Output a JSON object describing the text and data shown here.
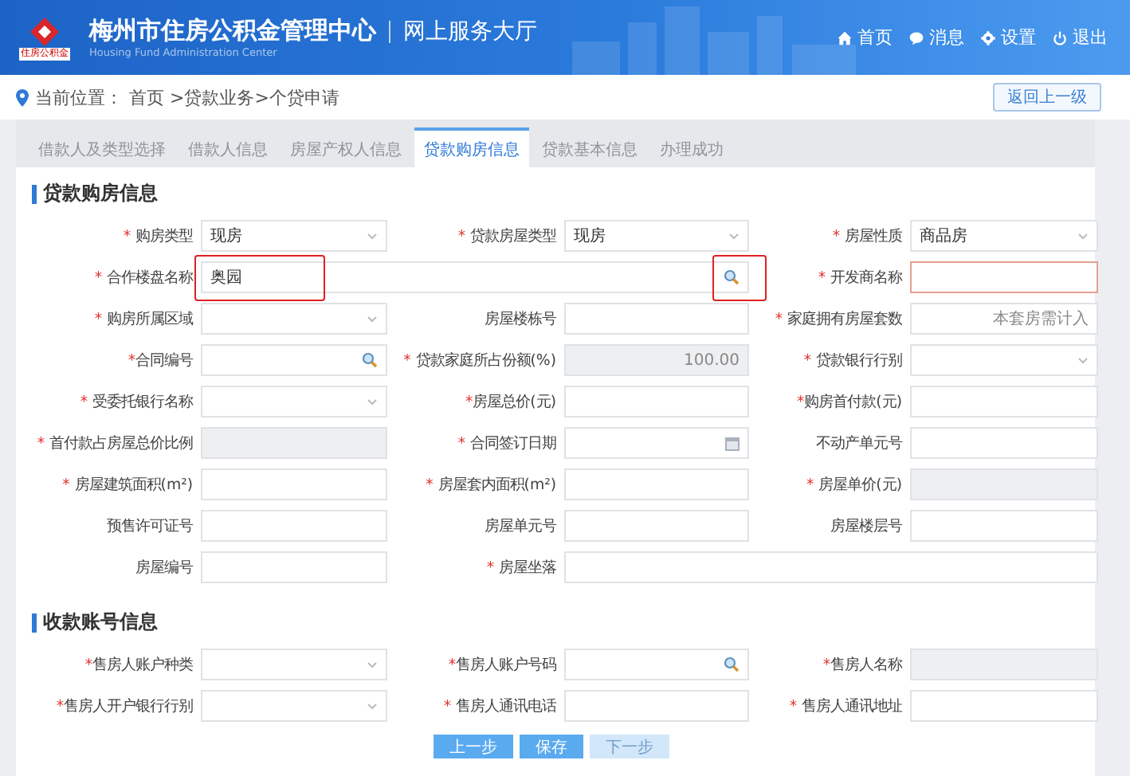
{
  "header": {
    "logo_caption": "住房公积金",
    "title": "梅州市住房公积金管理中心",
    "subtitle": "网上服务大厅",
    "english": "Housing Fund Administration Center",
    "nav": [
      {
        "kind": "home",
        "label": "首页"
      },
      {
        "kind": "message",
        "label": "消息"
      },
      {
        "kind": "settings",
        "label": "设置"
      },
      {
        "kind": "logout",
        "label": "退出"
      }
    ]
  },
  "breadcrumb": {
    "label": "当前位置：",
    "path": "首页 >贷款业务>个贷申请",
    "back_button": "返回上一级"
  },
  "tabs": [
    {
      "label": "借款人及类型选择",
      "selected": false
    },
    {
      "label": "借款人信息",
      "selected": false
    },
    {
      "label": "房屋产权人信息",
      "selected": false
    },
    {
      "label": "贷款购房信息",
      "selected": true
    },
    {
      "label": "贷款基本信息",
      "selected": false
    },
    {
      "label": "办理成功",
      "selected": false
    }
  ],
  "sections": [
    {
      "title": "贷款购房信息",
      "fields": [
        {
          "label": "购房类型",
          "mark": "* ",
          "kind": "select",
          "value": "现房"
        },
        {
          "label": "贷款房屋类型",
          "mark": "* ",
          "kind": "select",
          "value": "现房"
        },
        {
          "label": "房屋性质",
          "mark": "* ",
          "kind": "select",
          "value": "商品房"
        },
        {
          "label": "合作楼盘名称",
          "mark": "* ",
          "kind": "search",
          "value": "奥园",
          "wide": true,
          "marked": true
        },
        {
          "label": "开发商名称",
          "mark": "* ",
          "kind": "text",
          "error": true
        },
        {
          "label": "购房所属区域",
          "mark": "* ",
          "kind": "select"
        },
        {
          "label": "房屋楼栋号",
          "kind": "text"
        },
        {
          "label": "家庭拥有房屋套数",
          "mark": "* ",
          "kind": "text",
          "placeholder": "本套房需计入"
        },
        {
          "label": "合同编号",
          "mark": "*",
          "kind": "search"
        },
        {
          "label": "贷款家庭所占份额(%)",
          "mark": "* ",
          "kind": "disabled",
          "value": "100.00"
        },
        {
          "label": "贷款银行行别",
          "mark": "* ",
          "kind": "select"
        },
        {
          "label": "受委托银行名称",
          "mark": "* ",
          "kind": "select"
        },
        {
          "label": "房屋总价(元)",
          "mark": "*",
          "kind": "text"
        },
        {
          "label": "购房首付款(元)",
          "mark": "*",
          "kind": "text"
        },
        {
          "label": "首付款占房屋总价比例",
          "mark": "* ",
          "kind": "disabled"
        },
        {
          "label": "合同签订日期",
          "mark": "* ",
          "kind": "date"
        },
        {
          "label": "不动产单元号",
          "kind": "text"
        },
        {
          "label": "房屋建筑面积(m²)",
          "mark": "* ",
          "kind": "text"
        },
        {
          "label": "房屋套内面积(m²)",
          "mark": "* ",
          "kind": "text"
        },
        {
          "label": "房屋单价(元)",
          "mark": "* ",
          "kind": "disabled"
        },
        {
          "label": "预售许可证号",
          "kind": "text"
        },
        {
          "label": "房屋单元号",
          "kind": "text"
        },
        {
          "label": "房屋楼层号",
          "kind": "text"
        },
        {
          "label": "房屋编号",
          "kind": "text"
        },
        {
          "label": "房屋坐落",
          "mark": "* ",
          "kind": "text",
          "wide": true
        }
      ]
    },
    {
      "title": "收款账号信息",
      "fields": [
        {
          "label": "售房人账户种类",
          "mark": "*",
          "kind": "select"
        },
        {
          "label": "售房人账户号码",
          "mark": "*",
          "kind": "search"
        },
        {
          "label": "售房人名称",
          "mark": "*",
          "kind": "disabled"
        },
        {
          "label": "售房人开户银行行别",
          "mark": "*",
          "kind": "select"
        },
        {
          "label": "售房人通讯电话",
          "mark": "* ",
          "kind": "text"
        },
        {
          "label": "售房人通讯地址",
          "mark": "* ",
          "kind": "text"
        }
      ]
    }
  ],
  "buttons": [
    {
      "label": "上一步",
      "disabled": false
    },
    {
      "label": "保存",
      "disabled": false
    },
    {
      "label": "下一步",
      "disabled": true
    }
  ]
}
